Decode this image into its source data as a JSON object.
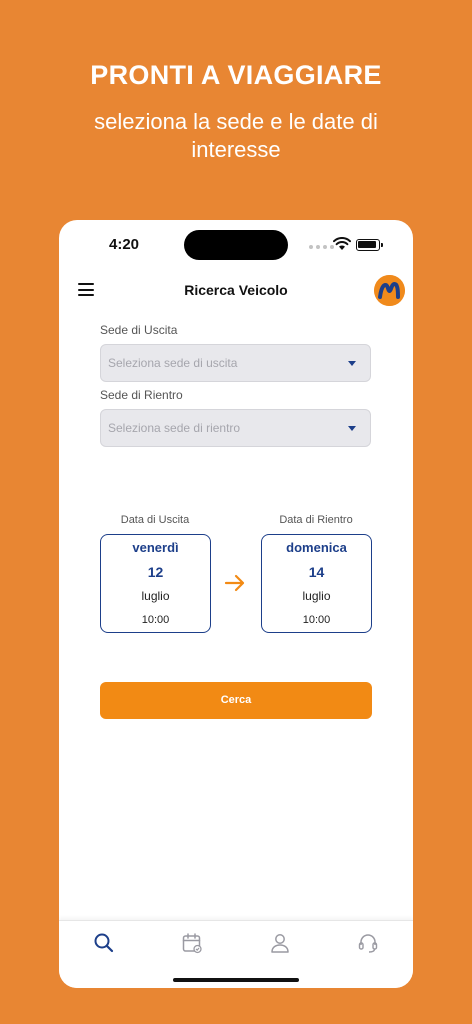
{
  "promo": {
    "title": "PRONTI A VIAGGIARE",
    "subtitle": "seleziona la sede e le date di interesse"
  },
  "status_bar": {
    "time": "4:20"
  },
  "header": {
    "title": "Ricerca Veicolo",
    "menu_icon": "hamburger-menu-icon",
    "avatar_icon": "m-logo-avatar"
  },
  "form": {
    "pickup": {
      "label": "Sede di Uscita",
      "placeholder": "Seleziona sede di uscita"
    },
    "return": {
      "label": "Sede di Rientro",
      "placeholder": "Seleziona sede di rientro"
    }
  },
  "dates": {
    "pickup": {
      "label": "Data di Uscita",
      "weekday": "venerdì",
      "day": "12",
      "month": "luglio",
      "time": "10:00"
    },
    "return": {
      "label": "Data di Rientro",
      "weekday": "domenica",
      "day": "14",
      "month": "luglio",
      "time": "10:00"
    }
  },
  "search_button": {
    "label": "Cerca"
  },
  "tabbar": {
    "items": [
      {
        "icon": "search-icon",
        "active": true
      },
      {
        "icon": "calendar-icon",
        "active": false
      },
      {
        "icon": "user-icon",
        "active": false
      },
      {
        "icon": "support-headset-icon",
        "active": false
      }
    ]
  },
  "colors": {
    "background": "#E88633",
    "accent": "#F28A14",
    "primary_blue": "#1D3F8A"
  }
}
